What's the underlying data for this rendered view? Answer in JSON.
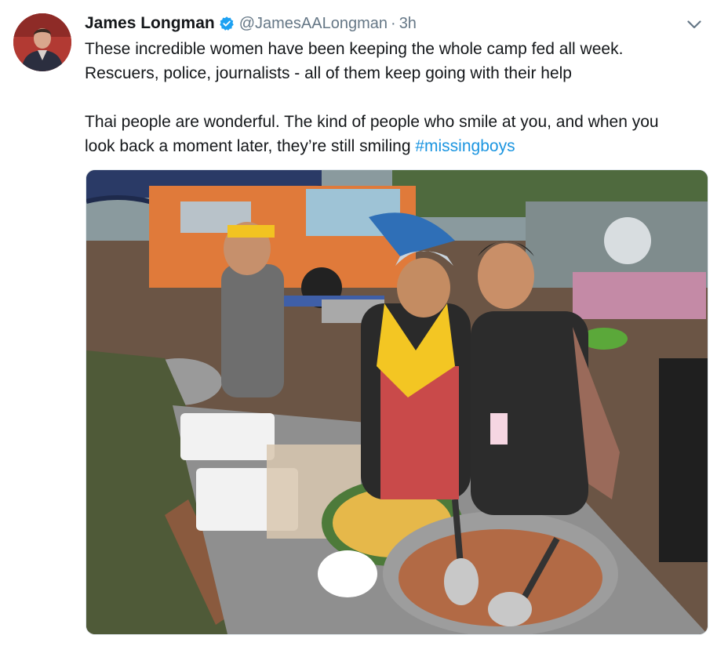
{
  "tweet": {
    "author_name": "James Longman",
    "handle": "@JamesAALongman",
    "separator": "·",
    "time": "3h",
    "line1": "These incredible women have been keeping the whole camp fed all week.",
    "line2": "Rescuers, police, journalists - all of them keep going with their help",
    "line3_text": "Thai people are wonderful. The kind of people who smile at you, and when you",
    "line4_text": "look back a moment later, they’re still smiling ",
    "hashtag": "#missingboys",
    "verified": true
  },
  "icons": {
    "verified": "verified-badge-icon",
    "more": "chevron-down-icon"
  },
  "colors": {
    "text": "#14171a",
    "secondary": "#657786",
    "link": "#1b95e0",
    "verified": "#1da1f2"
  }
}
